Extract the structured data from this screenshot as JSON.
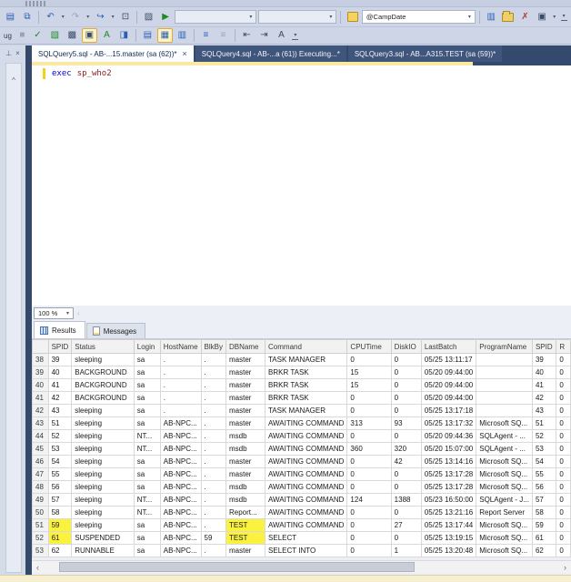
{
  "chrome": {
    "debug_label_clipped": "ug"
  },
  "toolbar_standard": {
    "combo1_value": "",
    "combo2_value": "",
    "variable_combo_value": "@CampDate"
  },
  "icons": {
    "paste": "▤",
    "copy": "⧉",
    "undo": "↶",
    "redo": "↷",
    "navigate": "↪",
    "window": "⊡",
    "image": "▨",
    "run": "▶",
    "caret": "▾",
    "link": "▥",
    "tools": "✗",
    "media": "▣",
    "pin": "⊥",
    "close": "×",
    "scroll_up": "^",
    "stop": "■",
    "parse": "✓",
    "estimated_plan": "▧",
    "query_options": "▩",
    "intellisense": "▣",
    "template_params": "A",
    "debug_pointer": "◨",
    "results_text": "▤",
    "results_grid": "▦",
    "results_file": "▥",
    "comment": "≡",
    "uncomment": "≡",
    "outdent": "⇤",
    "indent": "⇥",
    "case": "A",
    "scroll_left": "‹",
    "scroll_right": "›",
    "zoom_scroll": "‹"
  },
  "tabs": [
    {
      "label": "SQLQuery5.sql - AB-...15.master (sa (62))*",
      "close_glyph": "×",
      "active": true
    },
    {
      "label": "SQLQuery4.sql - AB-...a (61)) Executing...*",
      "active": false
    },
    {
      "label": "SQLQuery3.sql - AB...A315.TEST (sa (59))*",
      "active": false
    }
  ],
  "editor": {
    "line1_keyword": "exec",
    "line1_text": "sp_who2"
  },
  "results": {
    "zoom_level": "100 %",
    "tabs": [
      "Results",
      "Messages"
    ],
    "columns": [
      "",
      "SPID",
      "Status",
      "Login",
      "HostName",
      "BlkBy",
      "DBName",
      "Command",
      "CPUTime",
      "DiskIO",
      "LastBatch",
      "ProgramName",
      "SPID",
      "R"
    ],
    "rows": [
      [
        "38",
        "39",
        "sleeping",
        "sa",
        ".",
        ".",
        "master",
        "TASK MANAGER",
        "0",
        "0",
        "05/25 13:11:17",
        "",
        "39",
        "0"
      ],
      [
        "39",
        "40",
        "BACKGROUND",
        "sa",
        ".",
        ".",
        "master",
        "BRKR TASK",
        "15",
        "0",
        "05/20 09:44:00",
        "",
        "40",
        "0"
      ],
      [
        "40",
        "41",
        "BACKGROUND",
        "sa",
        ".",
        ".",
        "master",
        "BRKR TASK",
        "15",
        "0",
        "05/20 09:44:00",
        "",
        "41",
        "0"
      ],
      [
        "41",
        "42",
        "BACKGROUND",
        "sa",
        ".",
        ".",
        "master",
        "BRKR TASK",
        "0",
        "0",
        "05/20 09:44:00",
        "",
        "42",
        "0"
      ],
      [
        "42",
        "43",
        "sleeping",
        "sa",
        ".",
        ".",
        "master",
        "TASK MANAGER",
        "0",
        "0",
        "05/25 13:17:18",
        "",
        "43",
        "0"
      ],
      [
        "43",
        "51",
        "sleeping",
        "sa",
        "AB-NPC...",
        ".",
        "master",
        "AWAITING COMMAND",
        "313",
        "93",
        "05/25 13:17:32",
        "Microsoft SQ...",
        "51",
        "0"
      ],
      [
        "44",
        "52",
        "sleeping",
        "NT...",
        "AB-NPC...",
        ".",
        "msdb",
        "AWAITING COMMAND",
        "0",
        "0",
        "05/20 09:44:36",
        "SQLAgent - ...",
        "52",
        "0"
      ],
      [
        "45",
        "53",
        "sleeping",
        "NT...",
        "AB-NPC...",
        ".",
        "msdb",
        "AWAITING COMMAND",
        "360",
        "320",
        "05/20 15:07:00",
        "SQLAgent - ...",
        "53",
        "0"
      ],
      [
        "46",
        "54",
        "sleeping",
        "sa",
        "AB-NPC...",
        ".",
        "master",
        "AWAITING COMMAND",
        "0",
        "42",
        "05/25 13:14:16",
        "Microsoft SQ...",
        "54",
        "0"
      ],
      [
        "47",
        "55",
        "sleeping",
        "sa",
        "AB-NPC...",
        ".",
        "master",
        "AWAITING COMMAND",
        "0",
        "0",
        "05/25 13:17:28",
        "Microsoft SQ...",
        "55",
        "0"
      ],
      [
        "48",
        "56",
        "sleeping",
        "sa",
        "AB-NPC...",
        ".",
        "msdb",
        "AWAITING COMMAND",
        "0",
        "0",
        "05/25 13:17:28",
        "Microsoft SQ...",
        "56",
        "0"
      ],
      [
        "49",
        "57",
        "sleeping",
        "NT...",
        "AB-NPC...",
        ".",
        "msdb",
        "AWAITING COMMAND",
        "124",
        "1388",
        "05/23 16:50:00",
        "SQLAgent - J...",
        "57",
        "0"
      ],
      [
        "50",
        "58",
        "sleeping",
        "NT...",
        "AB-NPC...",
        ".",
        "Report...",
        "AWAITING COMMAND",
        "0",
        "0",
        "05/25 13:21:16",
        "Report Server",
        "58",
        "0"
      ],
      [
        "51",
        "59",
        "sleeping",
        "sa",
        "AB-NPC...",
        ".",
        "TEST",
        "AWAITING COMMAND",
        "0",
        "27",
        "05/25 13:17:44",
        "Microsoft SQ...",
        "59",
        "0"
      ],
      [
        "52",
        "61",
        "SUSPENDED",
        "sa",
        "AB-NPC...",
        "59",
        "TEST",
        "SELECT",
        "0",
        "0",
        "05/25 13:19:15",
        "Microsoft SQ...",
        "61",
        "0"
      ],
      [
        "53",
        "62",
        "RUNNABLE",
        "sa",
        "AB-NPC...",
        ".",
        "master",
        "SELECT INTO",
        "0",
        "1",
        "05/25 13:20:48",
        "Microsoft SQ...",
        "62",
        "0"
      ]
    ],
    "highlighted_cells": [
      {
        "row": 13,
        "cols": [
          1,
          6
        ]
      },
      {
        "row": 14,
        "cols": [
          1,
          6
        ]
      }
    ],
    "highlight_color": "#fbf23f"
  }
}
